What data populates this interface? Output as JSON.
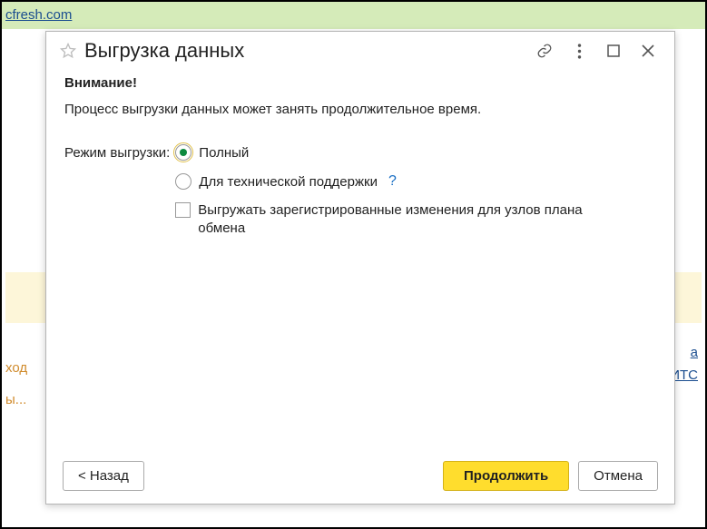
{
  "bg": {
    "link": "cfresh.com",
    "sideLeft": [
      "ход",
      "ы..."
    ],
    "sideRight": [
      "а",
      "ИТС"
    ]
  },
  "dialog": {
    "title": "Выгрузка данных",
    "warningHeader": "Внимание!",
    "infoText": "Процесс выгрузки данных может занять продолжительное время.",
    "modeLabel": "Режим выгрузки:",
    "options": {
      "full": "Полный",
      "support": "Для технической поддержки",
      "changes": "Выгружать зарегистрированные изменения для узлов плана обмена"
    },
    "helpMark": "?",
    "buttons": {
      "back": "< Назад",
      "continue": "Продолжить",
      "cancel": "Отмена"
    }
  }
}
